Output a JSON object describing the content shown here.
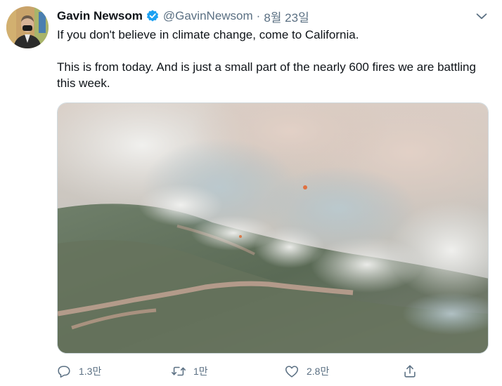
{
  "tweet": {
    "author_name": "Gavin Newsom",
    "handle": "@GavinNewsom",
    "separator": "·",
    "date": "8월 23일",
    "text_line1": "If you don't believe in climate change, come to California.",
    "text_line2": "This is from today. And is just a small part of the nearly 600 fires we are battling this week."
  },
  "actions": {
    "reply_count": "1.3만",
    "retweet_count": "1만",
    "like_count": "2.8만"
  },
  "icons": {
    "verified": "verified-badge-icon",
    "caret": "chevron-down-icon",
    "reply": "reply-icon",
    "retweet": "retweet-icon",
    "like": "heart-icon",
    "share": "share-icon"
  },
  "colors": {
    "verified_blue": "#1da1f2",
    "secondary_text": "#5b7083",
    "primary_text": "#0f1419"
  }
}
